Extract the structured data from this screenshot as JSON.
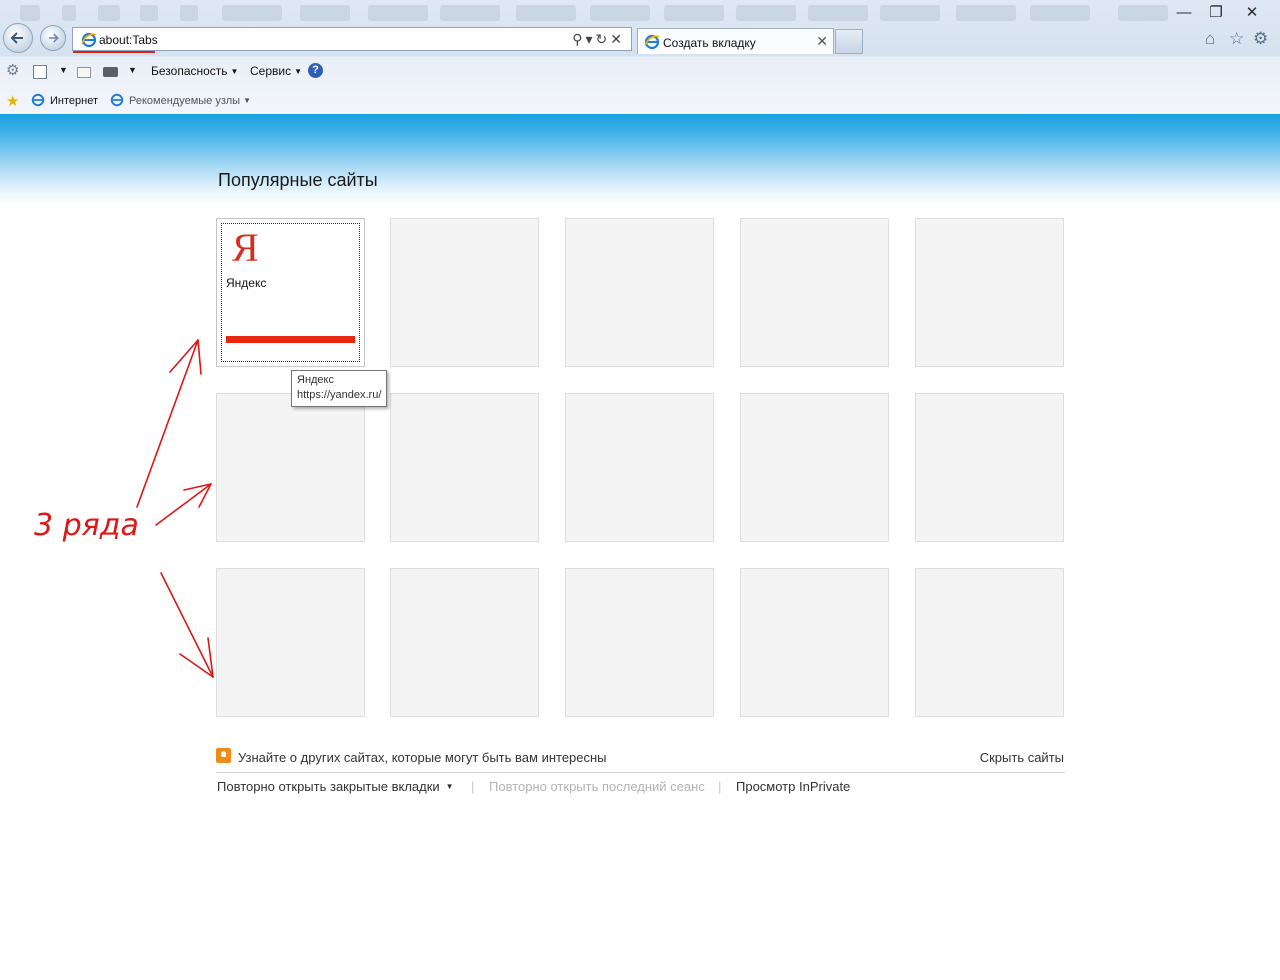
{
  "browser": {
    "address": "about:Tabs",
    "tab_title": "Создать вкладку",
    "menu": {
      "security": "Безопасность",
      "service": "Сервис"
    },
    "favorites": {
      "internet": "Интернет",
      "recommended": "Рекомендуемые узлы"
    }
  },
  "page": {
    "heading": "Популярные сайты",
    "site": {
      "logo": "Я",
      "name": "Яндекс",
      "accent": "#e8280c"
    },
    "tooltip": {
      "title": "Яндекс",
      "url": "https://yandex.ru/"
    },
    "learn_more": "Узнайте о других сайтах, которые могут быть вам интересны",
    "hide_sites": "Скрыть сайты",
    "reopen_tabs": "Повторно открыть закрытые вкладки",
    "reopen_session": "Повторно открыть последний сеанс",
    "inprivate": "Просмотр InPrivate"
  },
  "annotation": {
    "text": "3 ряда",
    "color": "#e01515"
  }
}
